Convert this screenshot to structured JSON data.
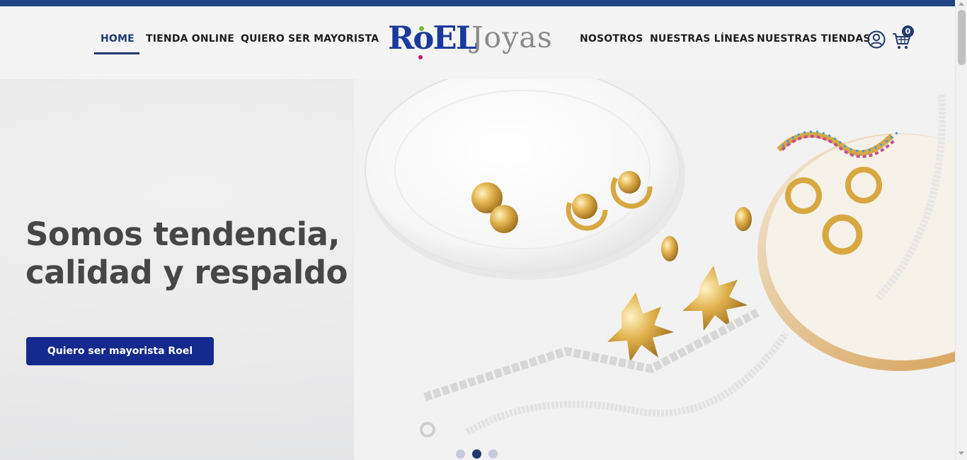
{
  "nav": {
    "left": [
      {
        "label": "HOME",
        "active": true
      },
      {
        "label": "TIENDA ONLINE"
      },
      {
        "label": "QUIERO SER MAYORISTA"
      }
    ],
    "right": [
      {
        "label": "NOSOTROS"
      },
      {
        "label": "NUESTRAS LÍNEAS"
      },
      {
        "label": "NUESTRAS TIENDAS"
      }
    ]
  },
  "logo": {
    "roel": "RoEL",
    "joyas": "Joyas"
  },
  "cart": {
    "count": "0"
  },
  "hero": {
    "title_line1": "Somos tendencia,",
    "title_line2": "calidad y respaldo",
    "button_label": "Quiero ser mayorista Roel"
  },
  "carousel": {
    "slides": 3,
    "active_index": 1
  },
  "colors": {
    "brand_navy": "#1f3a6e",
    "button_blue": "#142a8f",
    "top_bar": "#1f4583"
  },
  "icons": [
    "user-account-icon",
    "shopping-cart-icon"
  ]
}
